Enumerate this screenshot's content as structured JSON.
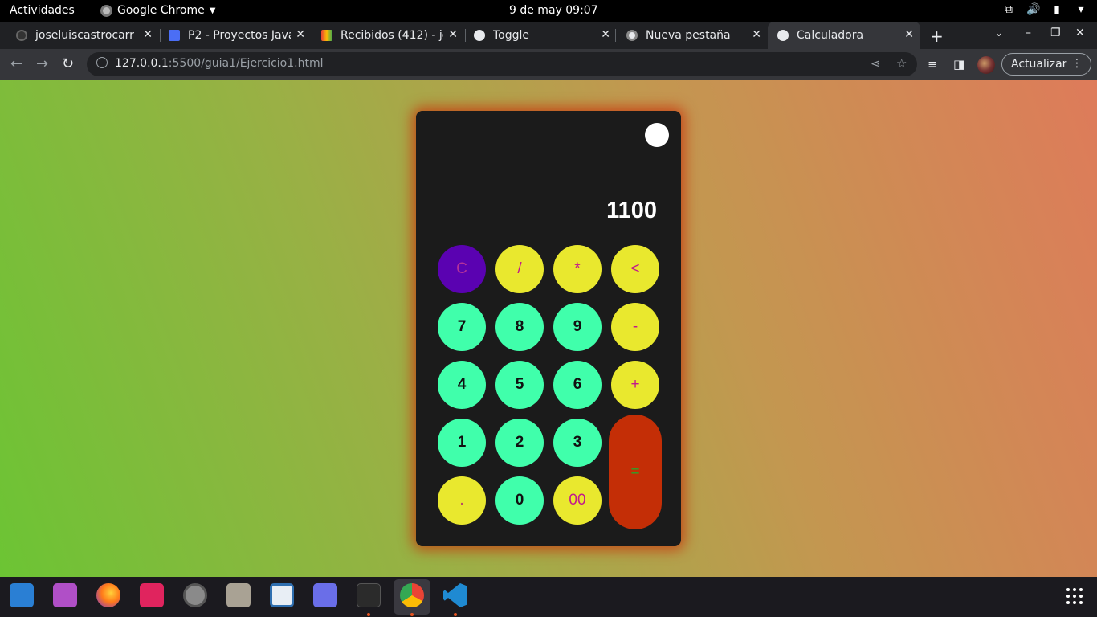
{
  "system_bar": {
    "activities": "Actividades",
    "app_name": "Google Chrome",
    "clock": "9 de may  09:07"
  },
  "browser": {
    "tabs": [
      {
        "title": "joseluiscastrocarr",
        "icon": "github-icon"
      },
      {
        "title": "P2 - Proyectos Java",
        "icon": "classroom-icon"
      },
      {
        "title": "Recibidos (412) - jo",
        "icon": "gmail-icon"
      },
      {
        "title": "Toggle",
        "icon": "globe-icon"
      },
      {
        "title": "Nueva pestaña",
        "icon": "chrome-icon"
      },
      {
        "title": "Calculadora",
        "icon": "globe-icon",
        "active": true
      }
    ],
    "url_host": "127.0.0.1",
    "url_path": ":5500/guia1/Ejercicio1.html",
    "update_button": "Actualizar"
  },
  "calculator": {
    "display": "1100",
    "keys": [
      {
        "label": "C",
        "kind": "clear"
      },
      {
        "label": "/",
        "kind": "op"
      },
      {
        "label": "*",
        "kind": "op"
      },
      {
        "label": "<",
        "kind": "op"
      },
      {
        "label": "7",
        "kind": "num"
      },
      {
        "label": "8",
        "kind": "num"
      },
      {
        "label": "9",
        "kind": "num"
      },
      {
        "label": "-",
        "kind": "op"
      },
      {
        "label": "4",
        "kind": "num"
      },
      {
        "label": "5",
        "kind": "num"
      },
      {
        "label": "6",
        "kind": "num"
      },
      {
        "label": "+",
        "kind": "op"
      },
      {
        "label": "1",
        "kind": "num"
      },
      {
        "label": "2",
        "kind": "num"
      },
      {
        "label": "3",
        "kind": "num"
      },
      {
        "label": "=",
        "kind": "equals"
      },
      {
        "label": ".",
        "kind": "dot"
      },
      {
        "label": "0",
        "kind": "num"
      },
      {
        "label": "00",
        "kind": "op"
      }
    ]
  },
  "dock": {
    "apps": [
      "system-monitor-icon",
      "video-player-icon",
      "firefox-icon",
      "screenshot-crop-icon",
      "settings-icon",
      "files-icon",
      "text-editor-icon",
      "screenshot-icon",
      "terminal-icon",
      "chrome-icon",
      "vscode-icon"
    ]
  }
}
